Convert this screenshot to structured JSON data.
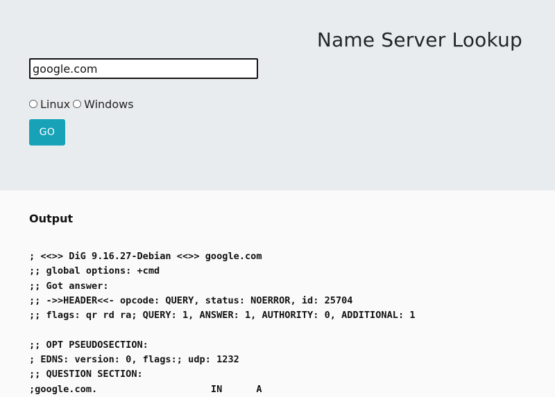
{
  "header": {
    "title": "Name Server Lookup"
  },
  "form": {
    "domain_value": "google.com",
    "os_options": [
      "Linux",
      "Windows"
    ],
    "go_label": "GO"
  },
  "output": {
    "heading": "Output",
    "lines": [
      "; <<>> DiG 9.16.27-Debian <<>> google.com",
      ";; global options: +cmd",
      ";; Got answer:",
      ";; ->>HEADER<<- opcode: QUERY, status: NOERROR, id: 25704",
      ";; flags: qr rd ra; QUERY: 1, ANSWER: 1, AUTHORITY: 0, ADDITIONAL: 1",
      "",
      ";; OPT PSEUDOSECTION:",
      "; EDNS: version: 0, flags:; udp: 1232",
      ";; QUESTION SECTION:",
      ";google.com.                    IN      A"
    ]
  },
  "colors": {
    "header_bg": "#e9ecef",
    "button": "#17a2b8",
    "body_bg": "#fafafa"
  }
}
